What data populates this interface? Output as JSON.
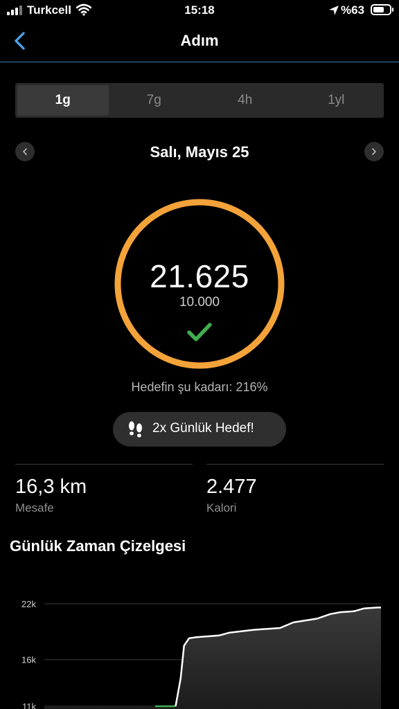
{
  "status_bar": {
    "carrier": "Turkcell",
    "time": "15:18",
    "battery_percent": "%63",
    "icons": [
      "signal-icon",
      "wifi-icon",
      "location-arrow-icon",
      "battery-icon"
    ]
  },
  "nav": {
    "title": "Adım",
    "back_icon": "chevron-left-icon"
  },
  "tabs": [
    {
      "label": "1g",
      "active": true
    },
    {
      "label": "7g",
      "active": false
    },
    {
      "label": "4h",
      "active": false
    },
    {
      "label": "1yl",
      "active": false
    }
  ],
  "date": {
    "label": "Salı, Mayıs 25",
    "prev_icon": "chevron-left-icon",
    "next_icon": "chevron-right-icon"
  },
  "progress": {
    "steps": "21.625",
    "goal": "10.000",
    "fraction": 2.1625,
    "ring_color": "#f3a33a",
    "check_color": "#3fae4f",
    "goal_text": "Hedefin şu kadarı: 216%"
  },
  "badge": {
    "icon": "footprints-icon",
    "label": "2x Günlük Hedef!"
  },
  "stats": [
    {
      "value": "16,3 km",
      "label": "Mesafe"
    },
    {
      "value": "2.477",
      "label": "Kalori"
    }
  ],
  "timeline": {
    "title": "Günlük Zaman Çizelgesi"
  },
  "chart_data": {
    "type": "area",
    "title": "Günlük Zaman Çizelgesi",
    "y_ticks": [
      "22k",
      "16k",
      "11k"
    ],
    "y_tick_values": [
      22000,
      16000,
      11000
    ],
    "ylim": [
      11000,
      22000
    ],
    "xlim": [
      0,
      100
    ],
    "grid": true,
    "line_color": "#ffffff",
    "accent_color": "#3fae4f",
    "x": [
      0,
      39,
      40.5,
      41.5,
      43,
      45,
      52,
      55,
      62,
      70,
      74,
      81,
      85,
      88,
      92,
      95,
      99,
      100
    ],
    "y": [
      11000,
      11000,
      14000,
      17500,
      18300,
      18400,
      18600,
      18900,
      19200,
      19400,
      20000,
      20400,
      20900,
      21100,
      21200,
      21500,
      21600,
      21600
    ]
  }
}
